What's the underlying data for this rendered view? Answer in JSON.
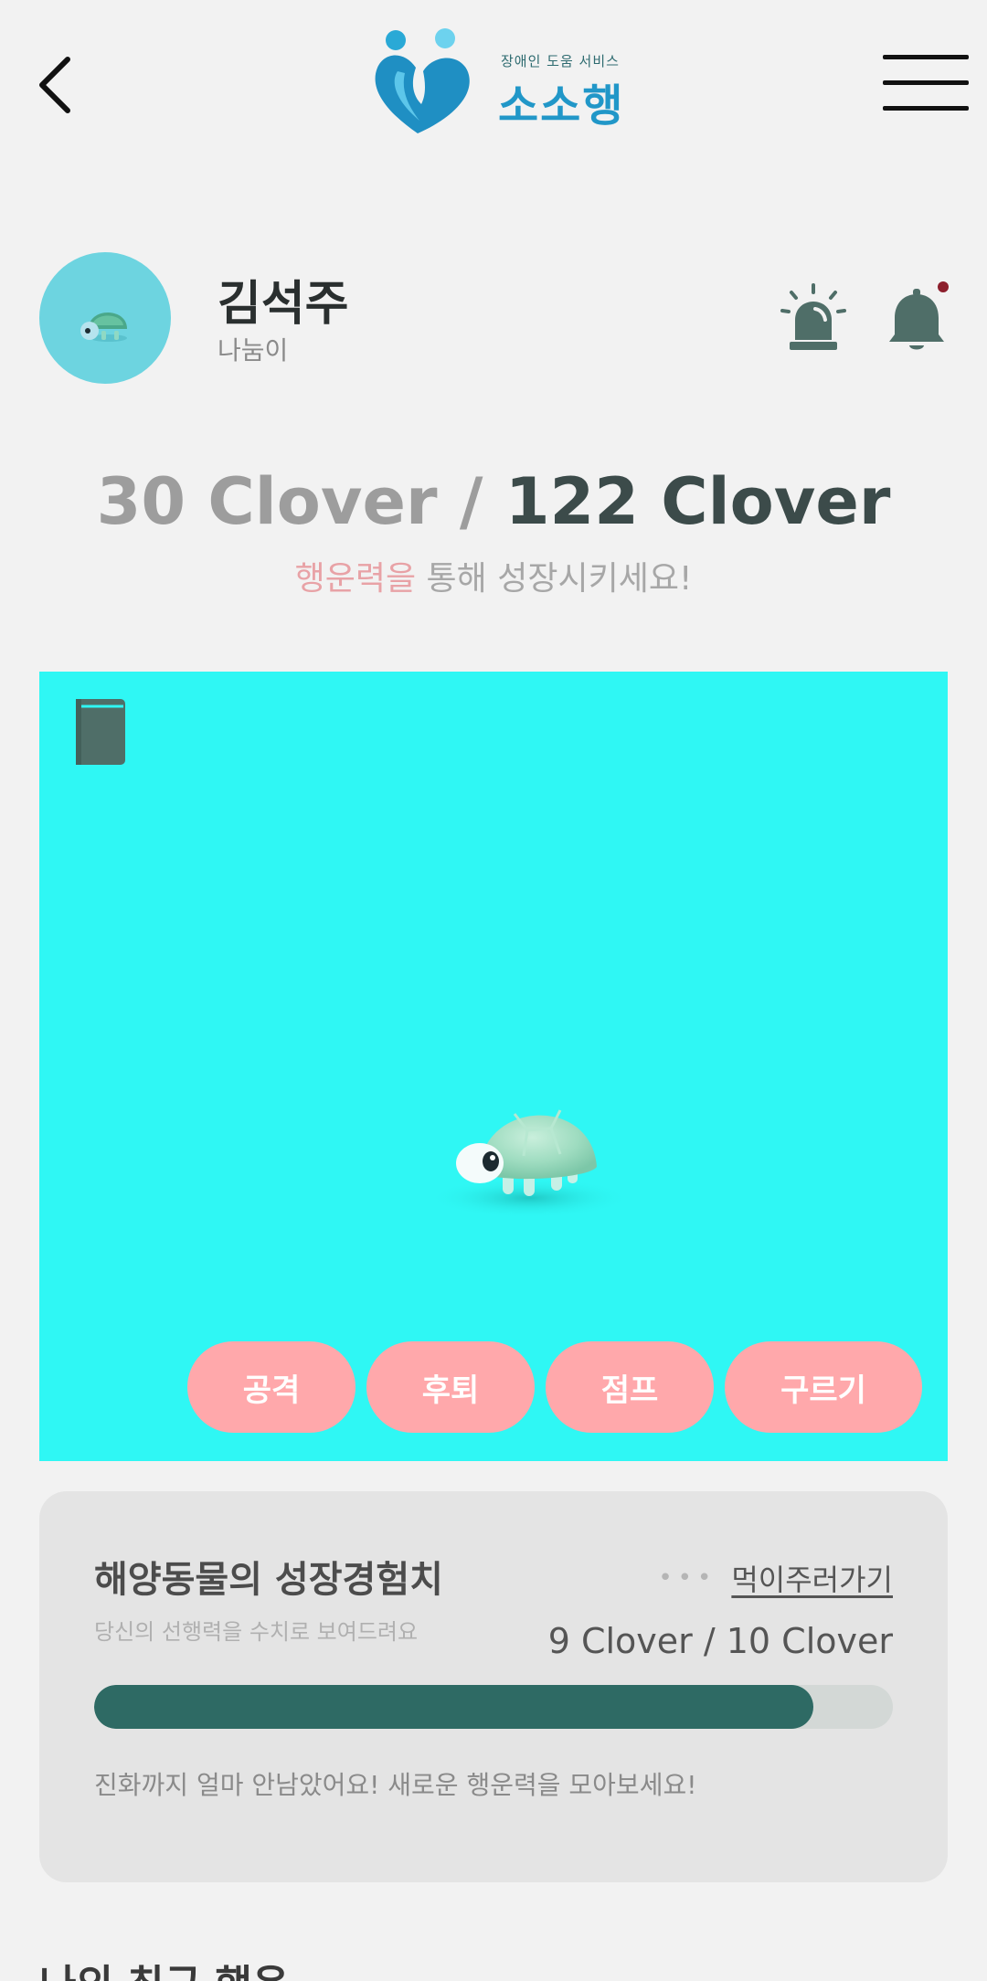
{
  "header": {
    "logo_sub": "장애인 도움 서비스",
    "logo_title": "소소행"
  },
  "profile": {
    "name": "김석주",
    "role": "나눔이"
  },
  "clover": {
    "current": "30 Clover",
    "separator": "/",
    "max": "122 Clover",
    "hint_accent": "행운력을",
    "hint_rest": " 통해 성장시키세요!"
  },
  "actions": [
    {
      "label": "공격"
    },
    {
      "label": "후퇴"
    },
    {
      "label": "점프"
    },
    {
      "label": "구르기"
    }
  ],
  "growth": {
    "title": "해양동물의 성장경험치",
    "subtitle": "당신의 선행력을 수치로 보여드려요",
    "feed_dots": "•••",
    "feed_link": "먹이주러가기",
    "exp_text": "9 Clover / 10 Clover",
    "progress": 0.9,
    "message": "진화까지 얼마 안남았어요! 새로운 행운력을 모아보세요!"
  },
  "recent": {
    "title": "나의 최근 행운"
  },
  "colors": {
    "stage_bg": "#2ff7f4",
    "action_btn": "#ffa8ab",
    "progress_fill": "#2e6a64",
    "icon_dark": "#4f6e68",
    "logo_blue": "#2197c8"
  }
}
